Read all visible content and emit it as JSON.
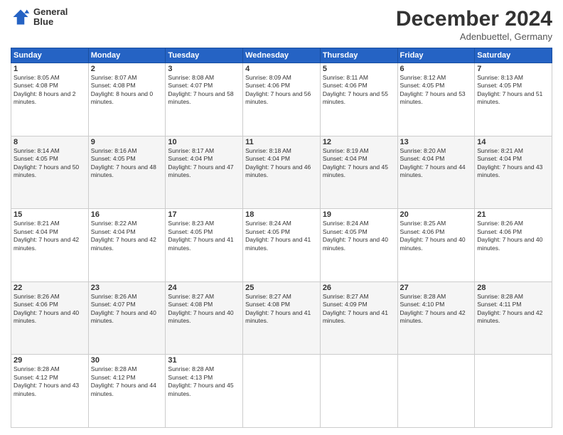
{
  "header": {
    "logo": {
      "line1": "General",
      "line2": "Blue"
    },
    "title": "December 2024",
    "location": "Adenbuettel, Germany"
  },
  "weekdays": [
    "Sunday",
    "Monday",
    "Tuesday",
    "Wednesday",
    "Thursday",
    "Friday",
    "Saturday"
  ],
  "weeks": [
    [
      {
        "day": "1",
        "sunrise": "8:05 AM",
        "sunset": "4:08 PM",
        "daylight": "8 hours and 2 minutes."
      },
      {
        "day": "2",
        "sunrise": "8:07 AM",
        "sunset": "4:08 PM",
        "daylight": "8 hours and 0 minutes."
      },
      {
        "day": "3",
        "sunrise": "8:08 AM",
        "sunset": "4:07 PM",
        "daylight": "7 hours and 58 minutes."
      },
      {
        "day": "4",
        "sunrise": "8:09 AM",
        "sunset": "4:06 PM",
        "daylight": "7 hours and 56 minutes."
      },
      {
        "day": "5",
        "sunrise": "8:11 AM",
        "sunset": "4:06 PM",
        "daylight": "7 hours and 55 minutes."
      },
      {
        "day": "6",
        "sunrise": "8:12 AM",
        "sunset": "4:05 PM",
        "daylight": "7 hours and 53 minutes."
      },
      {
        "day": "7",
        "sunrise": "8:13 AM",
        "sunset": "4:05 PM",
        "daylight": "7 hours and 51 minutes."
      }
    ],
    [
      {
        "day": "8",
        "sunrise": "8:14 AM",
        "sunset": "4:05 PM",
        "daylight": "7 hours and 50 minutes."
      },
      {
        "day": "9",
        "sunrise": "8:16 AM",
        "sunset": "4:05 PM",
        "daylight": "7 hours and 48 minutes."
      },
      {
        "day": "10",
        "sunrise": "8:17 AM",
        "sunset": "4:04 PM",
        "daylight": "7 hours and 47 minutes."
      },
      {
        "day": "11",
        "sunrise": "8:18 AM",
        "sunset": "4:04 PM",
        "daylight": "7 hours and 46 minutes."
      },
      {
        "day": "12",
        "sunrise": "8:19 AM",
        "sunset": "4:04 PM",
        "daylight": "7 hours and 45 minutes."
      },
      {
        "day": "13",
        "sunrise": "8:20 AM",
        "sunset": "4:04 PM",
        "daylight": "7 hours and 44 minutes."
      },
      {
        "day": "14",
        "sunrise": "8:21 AM",
        "sunset": "4:04 PM",
        "daylight": "7 hours and 43 minutes."
      }
    ],
    [
      {
        "day": "15",
        "sunrise": "8:21 AM",
        "sunset": "4:04 PM",
        "daylight": "7 hours and 42 minutes."
      },
      {
        "day": "16",
        "sunrise": "8:22 AM",
        "sunset": "4:04 PM",
        "daylight": "7 hours and 42 minutes."
      },
      {
        "day": "17",
        "sunrise": "8:23 AM",
        "sunset": "4:05 PM",
        "daylight": "7 hours and 41 minutes."
      },
      {
        "day": "18",
        "sunrise": "8:24 AM",
        "sunset": "4:05 PM",
        "daylight": "7 hours and 41 minutes."
      },
      {
        "day": "19",
        "sunrise": "8:24 AM",
        "sunset": "4:05 PM",
        "daylight": "7 hours and 40 minutes."
      },
      {
        "day": "20",
        "sunrise": "8:25 AM",
        "sunset": "4:06 PM",
        "daylight": "7 hours and 40 minutes."
      },
      {
        "day": "21",
        "sunrise": "8:26 AM",
        "sunset": "4:06 PM",
        "daylight": "7 hours and 40 minutes."
      }
    ],
    [
      {
        "day": "22",
        "sunrise": "8:26 AM",
        "sunset": "4:06 PM",
        "daylight": "7 hours and 40 minutes."
      },
      {
        "day": "23",
        "sunrise": "8:26 AM",
        "sunset": "4:07 PM",
        "daylight": "7 hours and 40 minutes."
      },
      {
        "day": "24",
        "sunrise": "8:27 AM",
        "sunset": "4:08 PM",
        "daylight": "7 hours and 40 minutes."
      },
      {
        "day": "25",
        "sunrise": "8:27 AM",
        "sunset": "4:08 PM",
        "daylight": "7 hours and 41 minutes."
      },
      {
        "day": "26",
        "sunrise": "8:27 AM",
        "sunset": "4:09 PM",
        "daylight": "7 hours and 41 minutes."
      },
      {
        "day": "27",
        "sunrise": "8:28 AM",
        "sunset": "4:10 PM",
        "daylight": "7 hours and 42 minutes."
      },
      {
        "day": "28",
        "sunrise": "8:28 AM",
        "sunset": "4:11 PM",
        "daylight": "7 hours and 42 minutes."
      }
    ],
    [
      {
        "day": "29",
        "sunrise": "8:28 AM",
        "sunset": "4:12 PM",
        "daylight": "7 hours and 43 minutes."
      },
      {
        "day": "30",
        "sunrise": "8:28 AM",
        "sunset": "4:12 PM",
        "daylight": "7 hours and 44 minutes."
      },
      {
        "day": "31",
        "sunrise": "8:28 AM",
        "sunset": "4:13 PM",
        "daylight": "7 hours and 45 minutes."
      },
      null,
      null,
      null,
      null
    ]
  ]
}
